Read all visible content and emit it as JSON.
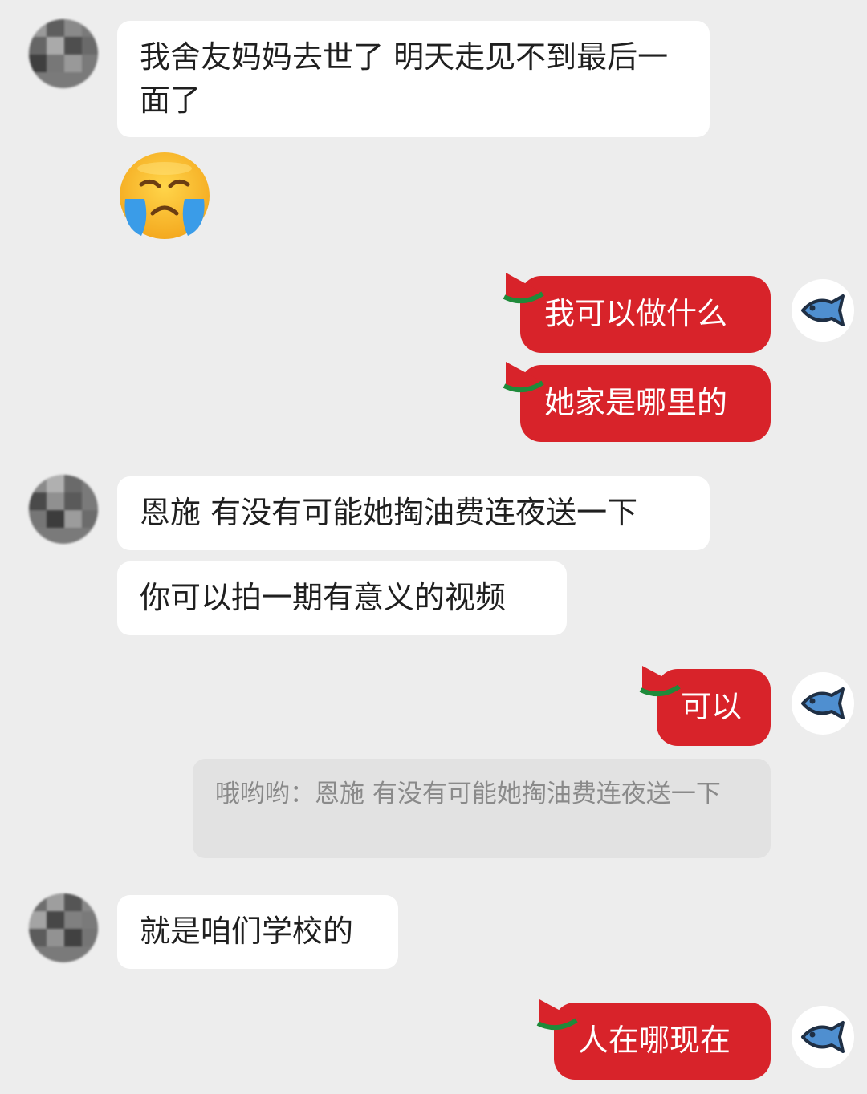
{
  "messages": [
    {
      "side": "left",
      "type": "text",
      "text": "我舍友妈妈去世了 明天走见不到最后一面了"
    },
    {
      "side": "left",
      "type": "emoji",
      "emoji": "crying-face-icon"
    },
    {
      "side": "right",
      "type": "text",
      "text": "我可以做什么"
    },
    {
      "side": "right",
      "type": "text",
      "text": "她家是哪里的"
    },
    {
      "side": "left",
      "type": "text",
      "text": "恩施 有没有可能她掏油费连夜送一下"
    },
    {
      "side": "left",
      "type": "text",
      "text": "你可以拍一期有意义的视频"
    },
    {
      "side": "right",
      "type": "text",
      "text": "可以"
    },
    {
      "side": "right",
      "type": "quote",
      "text": "哦哟哟：恩施 有没有可能她掏油费连夜送一下"
    },
    {
      "side": "left",
      "type": "text",
      "text": "就是咱们学校的"
    },
    {
      "side": "right",
      "type": "text",
      "text": "人在哪现在"
    }
  ],
  "colors": {
    "background": "#ededed",
    "incoming_bubble": "#ffffff",
    "outgoing_bubble": "#d8232a",
    "quote_bubble": "#e2e2e2",
    "fish_icon": "#4f8fd0"
  },
  "icons": {
    "self_avatar": "fish-icon",
    "other_avatar": "blurred-avatar"
  }
}
